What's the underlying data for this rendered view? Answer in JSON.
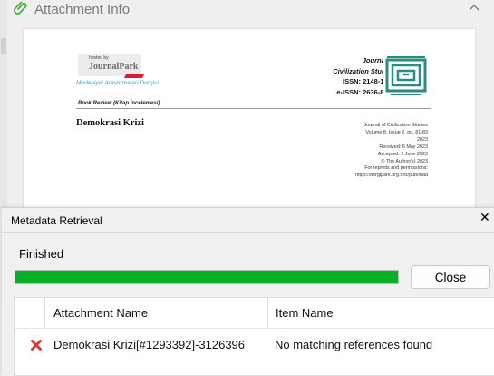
{
  "attachment_pane": {
    "title": "Attachment Info",
    "preview": {
      "logo_hosted": "hosted by",
      "logo_name": "JournalPark",
      "journal_subtitle": "Medeniyet Araştırmaları Dergisi",
      "section_label": "Book Review (Kitap İncelemesi)",
      "journal_lines": [
        "Journal of",
        "Civilization Studies",
        "ISSN: 2148-1652",
        "e-ISSN: 2636-8374"
      ],
      "article_title": "Demokrasi Krizi",
      "article_meta": [
        "Journal of Civilization Studies",
        "Volume 8, Issue 2, pp. 81-83",
        "2023",
        "Received: 6 May 2023",
        "Accepted: 2 June 2023",
        "© The Author(s) 2023",
        "For reprints and permissions:",
        "https://dergipark.org.tr/tr/pub/mad"
      ]
    }
  },
  "dialog": {
    "title": "Metadata Retrieval",
    "status": "Finished",
    "progress": 1.0,
    "close_label": "Close",
    "columns": [
      "Attachment Name",
      "Item Name"
    ],
    "rows": [
      {
        "attachment": "Demokrasi Krizi[#1293392]-3126396",
        "item": "No matching references found",
        "status_icon": "error-x-icon"
      }
    ]
  },
  "colors": {
    "progress_green": "#06b025",
    "error_red": "#d83b3b",
    "seal_teal": "#2a8c82",
    "journal_blue": "#3ba0d8"
  }
}
